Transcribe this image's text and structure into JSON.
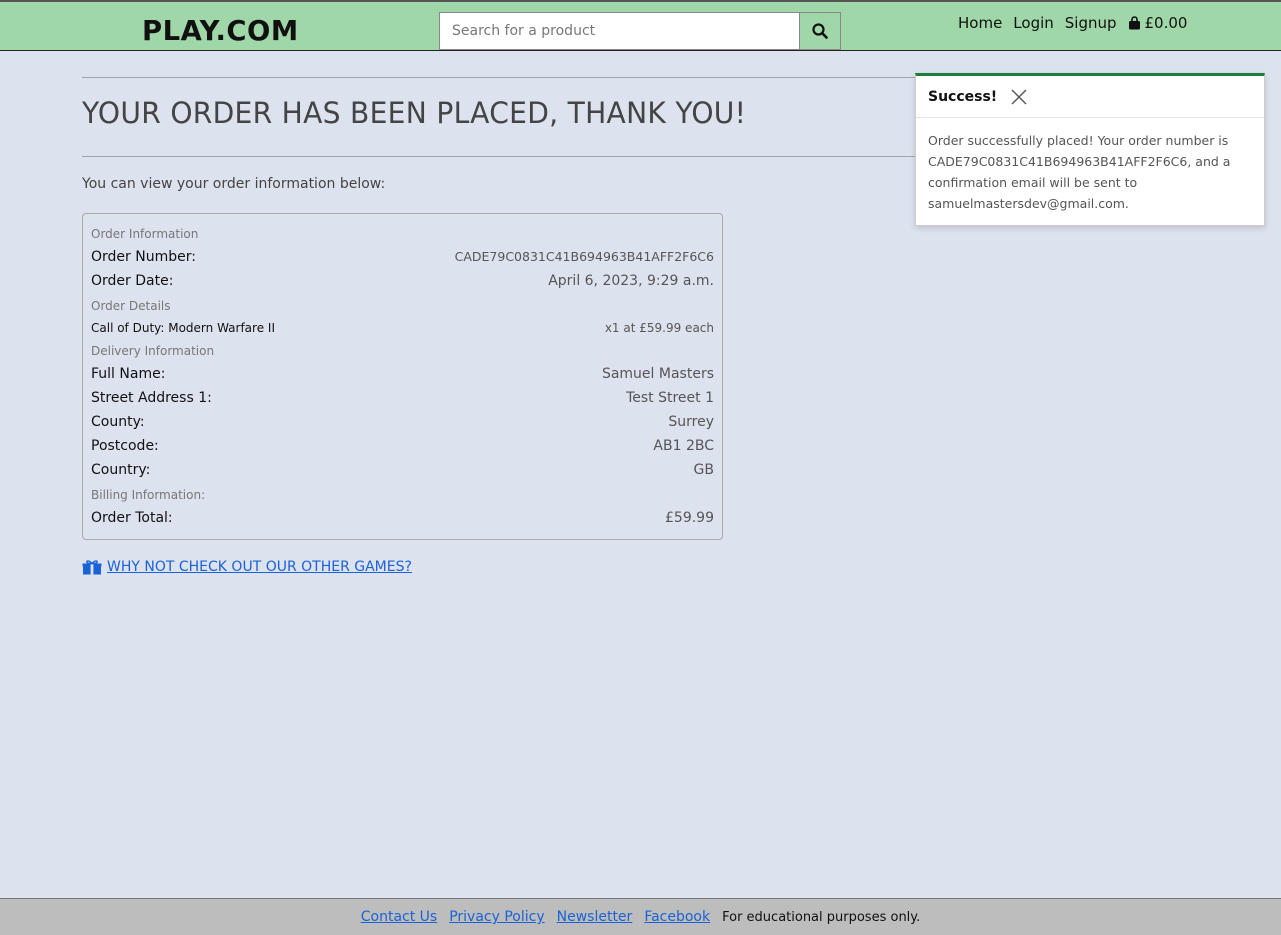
{
  "header": {
    "logo": "PLAY.COM",
    "search_placeholder": "Search for a product",
    "nav": {
      "home": "Home",
      "login": "Login",
      "signup": "Signup",
      "cart_total": "£0.00"
    }
  },
  "main": {
    "title": "YOUR ORDER HAS BEEN PLACED, THANK YOU!",
    "intro": "You can view your order information below:",
    "order": {
      "info_heading": "Order Information",
      "order_number_label": "Order Number:",
      "order_number": "CADE79C0831C41B694963B41AFF2F6C6",
      "order_date_label": "Order Date:",
      "order_date": "April 6, 2023, 9:29 a.m.",
      "details_heading": "Order Details",
      "item_name": "Call of Duty: Modern Warfare II",
      "item_qty": "x1 at £59.99 each",
      "delivery_heading": "Delivery Information",
      "full_name_label": "Full Name:",
      "full_name": "Samuel Masters",
      "street_label": "Street Address 1:",
      "street": "Test Street 1",
      "county_label": "County:",
      "county": "Surrey",
      "postcode_label": "Postcode:",
      "postcode": "AB1 2BC",
      "country_label": "Country:",
      "country": "GB",
      "billing_heading": "Billing Information:",
      "total_label": "Order Total:",
      "total": "£59.99"
    },
    "other_games_link": "WHY NOT CHECK OUT OUR OTHER GAMES?"
  },
  "toast": {
    "title": "Success!",
    "message": "Order successfully placed! Your order number is CADE79C0831C41B694963B41AFF2F6C6, and a confirmation email will be sent to samuelmastersdev@gmail.com."
  },
  "footer": {
    "links": [
      "Contact Us",
      "Privacy Policy",
      "Newsletter",
      "Facebook"
    ],
    "note": "For educational purposes only."
  },
  "colors": {
    "header_bg": "#9fd7a8",
    "page_bg": "#dde2ef",
    "link": "#1a62d6",
    "toast_accent": "#1b7f3a",
    "footer_bg": "#bdbdbd"
  },
  "icons": [
    "search-icon",
    "shopping-bag-icon",
    "close-icon",
    "gift-icon"
  ]
}
